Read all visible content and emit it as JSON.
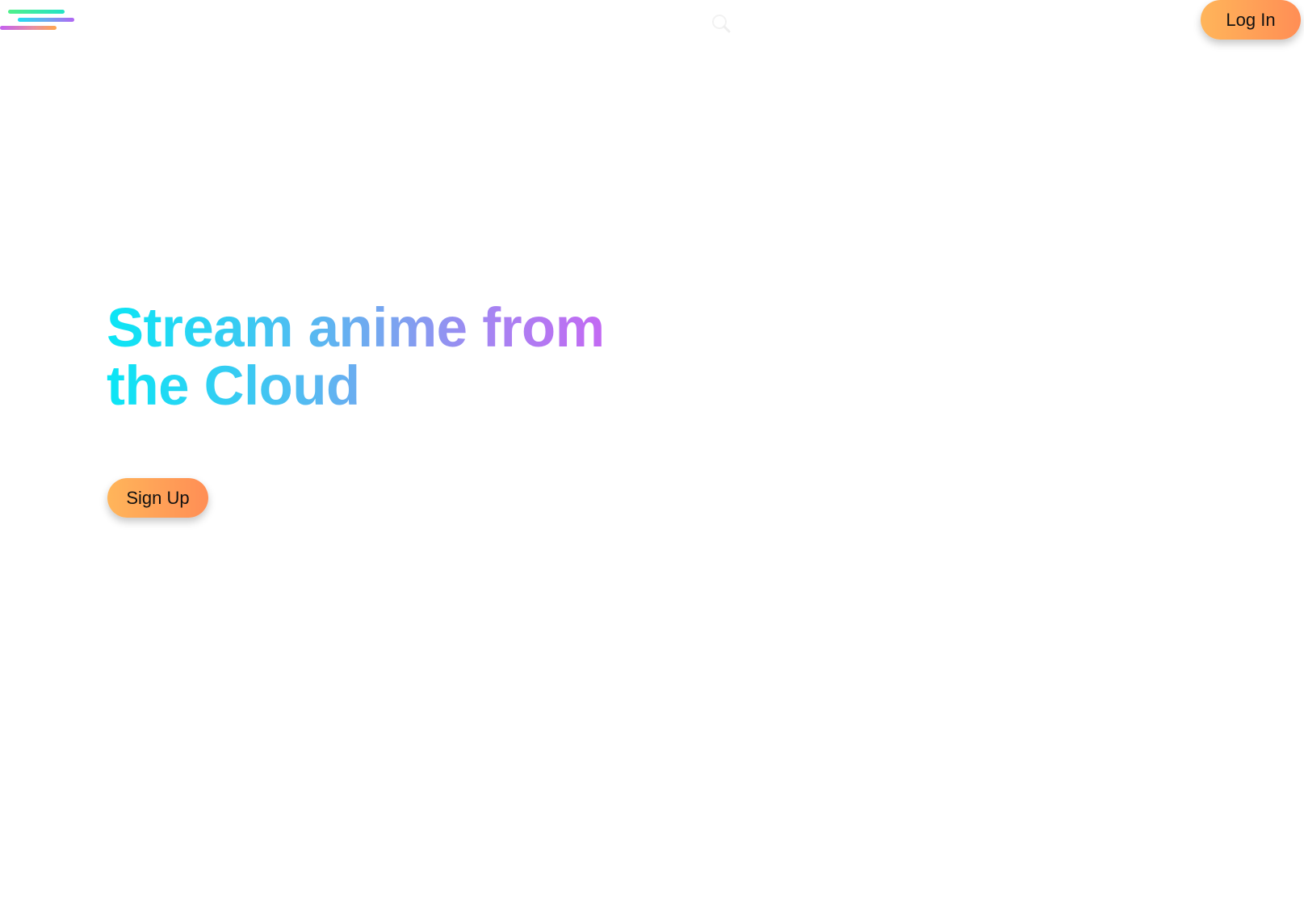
{
  "header": {
    "logo_icon": "three-gradient-bars-logo",
    "search_icon": "search-icon",
    "login_label": "Log In"
  },
  "hero": {
    "title_line1": "Stream anime from",
    "title_line2": "the Cloud",
    "signup_label": "Sign Up"
  },
  "colors": {
    "button_gradient_start": "#ffb55a",
    "button_gradient_end": "#ff8e55",
    "title_gradient_start": "#0ae6f5",
    "title_gradient_end": "#c865f3",
    "background": "#ffffff"
  }
}
